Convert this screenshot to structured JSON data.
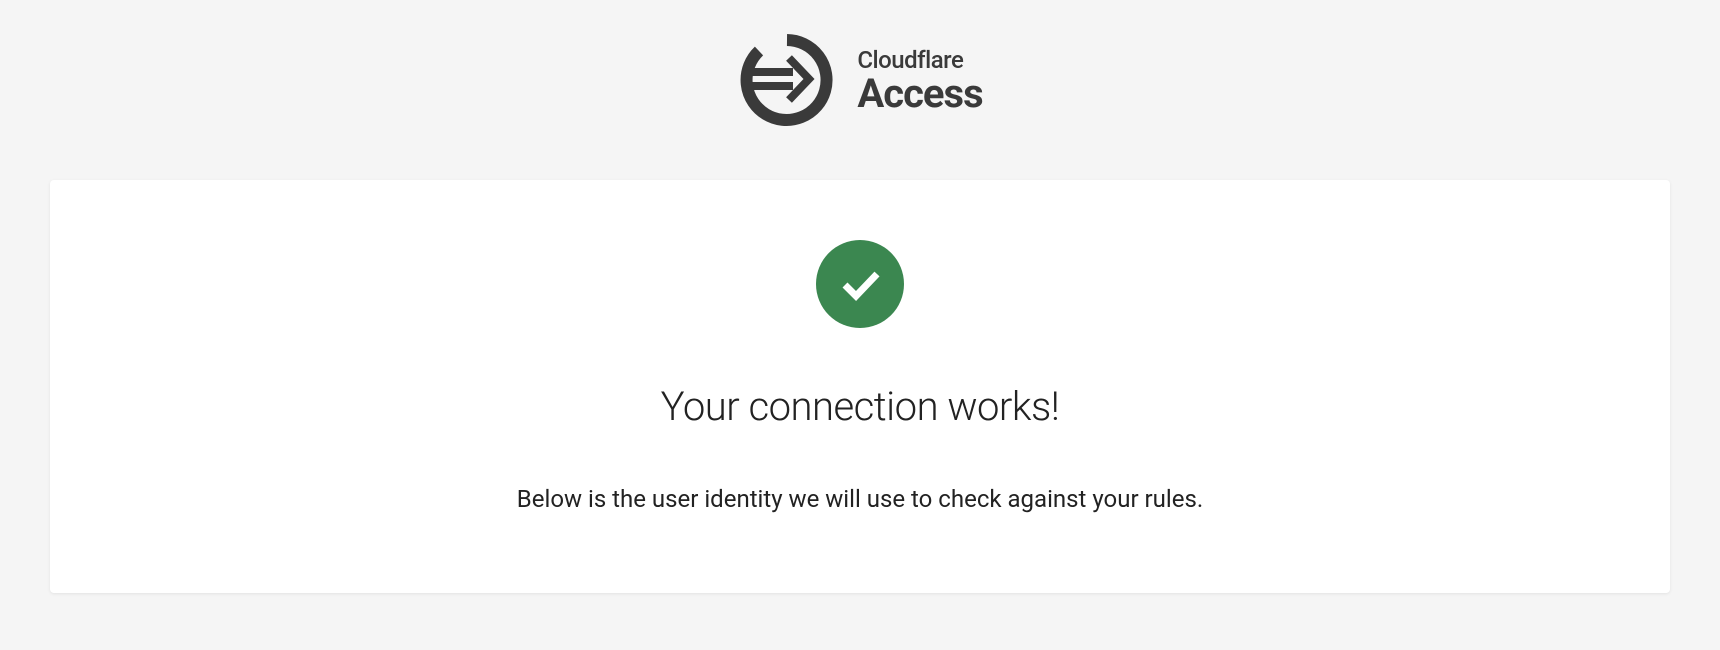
{
  "header": {
    "brand": "Cloudflare",
    "product": "Access"
  },
  "card": {
    "heading": "Your connection works!",
    "subheading": "Below is the user identity we will use to check against your rules."
  },
  "colors": {
    "success": "#3b8750",
    "text_dark": "#3a3a3a",
    "background": "#f5f5f5",
    "card_bg": "#ffffff"
  }
}
